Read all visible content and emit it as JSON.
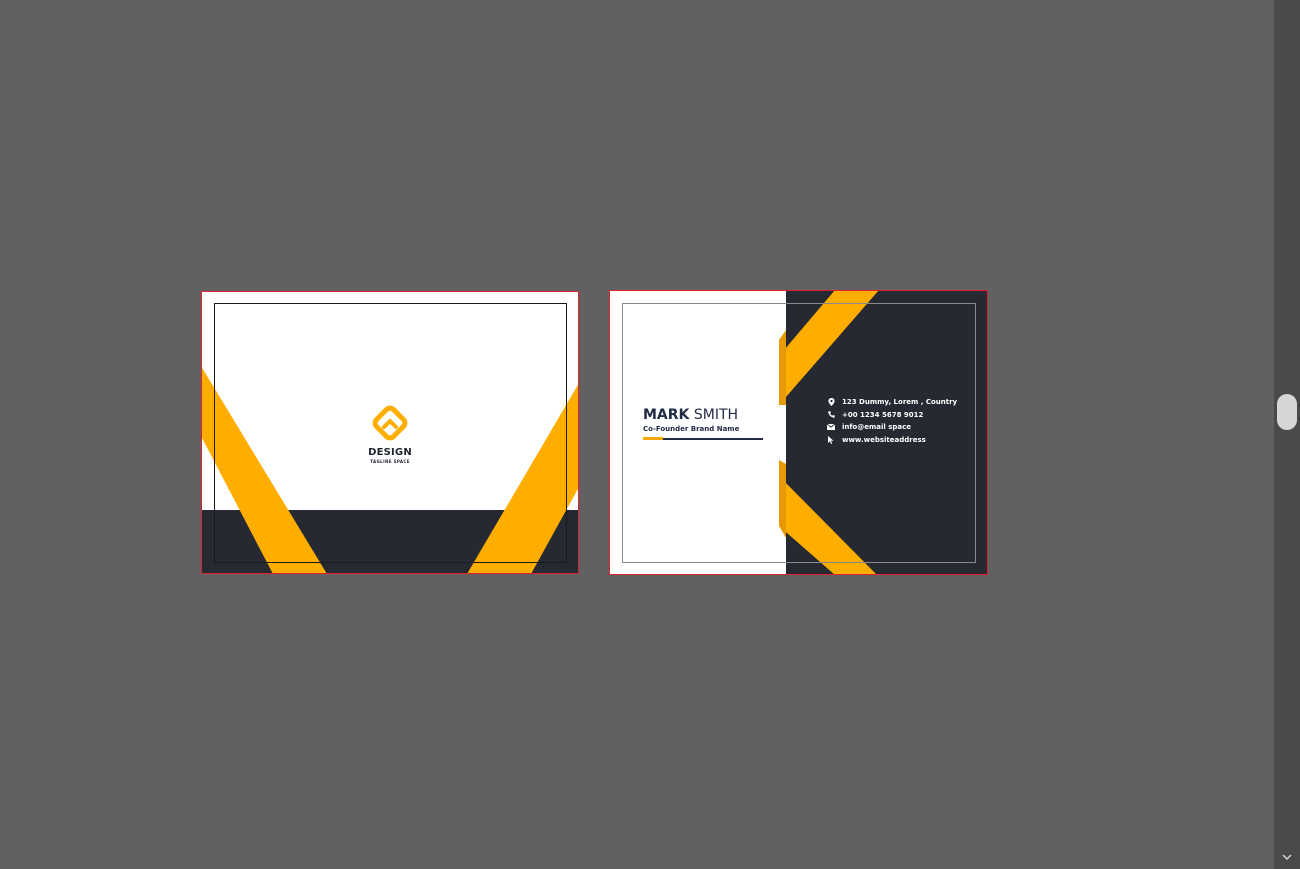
{
  "workspace": {
    "background": "#616161"
  },
  "front_card": {
    "logo": {
      "icon": "diamond-logo-icon",
      "word": "DESIGN",
      "tagline": "TAGLINE SPACE"
    },
    "colors": {
      "accent": "#FFAE00",
      "dark": "#262932",
      "background": "#FFFFFF"
    }
  },
  "back_card": {
    "name_first": "MARK",
    "name_last": "SMITH",
    "title": "Co-Founder Brand Name",
    "contacts": [
      {
        "icon": "location-pin-icon",
        "text": "123 Dummy, Lorem , Country"
      },
      {
        "icon": "phone-icon",
        "text": "+00 1234 5678 9012"
      },
      {
        "icon": "mail-icon",
        "text": "info@email space"
      },
      {
        "icon": "cursor-icon",
        "text": "www.websiteaddress"
      }
    ],
    "colors": {
      "accent": "#FFAE00",
      "dark": "#262932",
      "text_dark": "#1F2A44"
    }
  },
  "guides": {
    "bleed_color": "#E0202A"
  },
  "scrollbar": {
    "icon": "chevron-down-icon"
  }
}
